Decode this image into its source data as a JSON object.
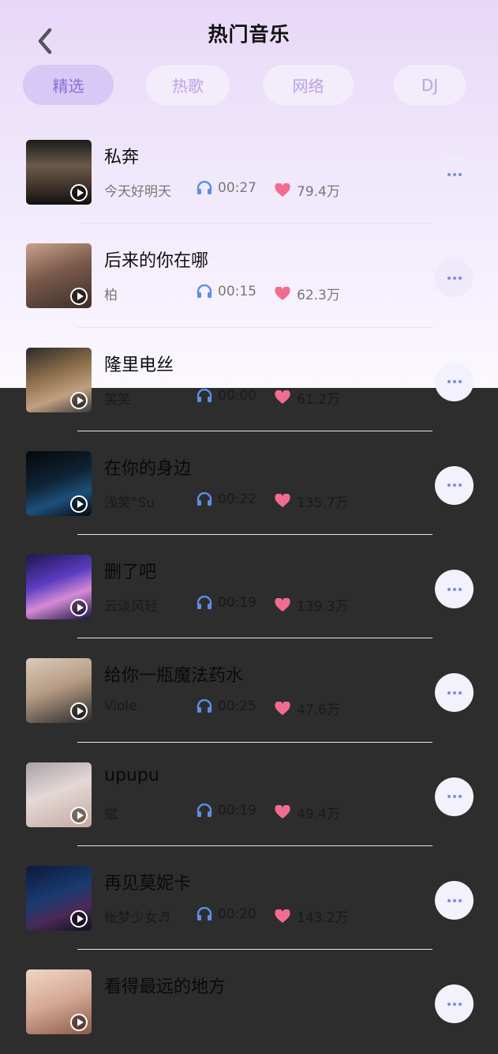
{
  "header": {
    "title": "热门音乐"
  },
  "tabs": [
    {
      "label": "精选"
    },
    {
      "label": "热歌"
    },
    {
      "label": "网络"
    },
    {
      "label": "DJ"
    }
  ],
  "songs": [
    {
      "title": "私奔",
      "artist": "今天好明天",
      "duration": "00:27",
      "likes": "79.4万"
    },
    {
      "title": "后来的你在哪",
      "artist": "柏",
      "duration": "00:15",
      "likes": "62.3万"
    },
    {
      "title": "隆里电丝",
      "artist": "笑笑",
      "duration": "00:00",
      "likes": "61.2万"
    },
    {
      "title": "在你的身边",
      "artist": "浅笑°Su",
      "duration": "00:22",
      "likes": "135.7万"
    },
    {
      "title": "删了吧",
      "artist": "云淡风轻",
      "duration": "00:19",
      "likes": "139.3万"
    },
    {
      "title": "给你一瓶魔法药水",
      "artist": "Viole",
      "duration": "00:25",
      "likes": "47.6万"
    },
    {
      "title": "upupu",
      "artist": "斌",
      "duration": "00:19",
      "likes": "49.4万"
    },
    {
      "title": "再见莫妮卡",
      "artist": "帐梦少女♬",
      "duration": "00:20",
      "likes": "143.2万"
    },
    {
      "title": "看得最远的地方",
      "artist": "",
      "duration": "",
      "likes": ""
    }
  ],
  "colors": {
    "accent": "#8a6fd4",
    "headphone": "#5b8fe8",
    "heart": "#f26c8f",
    "overlay": "#2d2d2d"
  }
}
